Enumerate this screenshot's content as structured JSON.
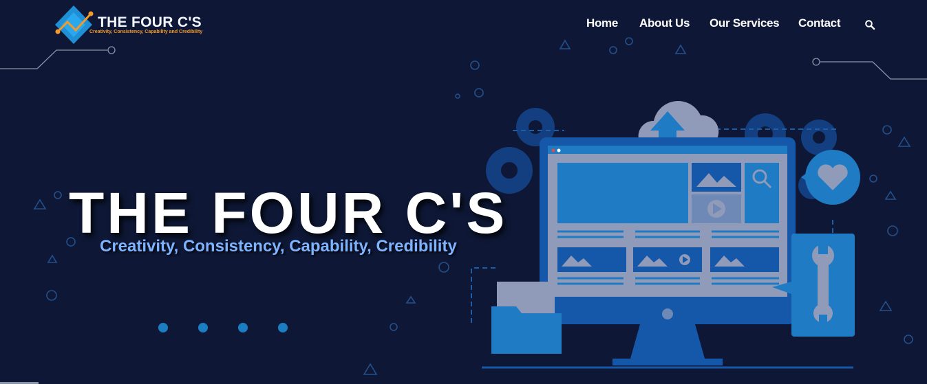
{
  "brand": {
    "name": "THE FOUR C'S",
    "tagline": "Creativity, Consistency, Capability and Credibility"
  },
  "nav": {
    "items": [
      {
        "label": "Home"
      },
      {
        "label": "About Us"
      },
      {
        "label": "Our Services"
      },
      {
        "label": "Contact"
      }
    ],
    "search_icon": "search-icon"
  },
  "hero": {
    "title": "THE FOUR C'S",
    "subtitle": "Creativity, Consistency, Capability, Credibility"
  },
  "slider": {
    "slide_count": 4
  },
  "colors": {
    "background": "#0e1836",
    "accent_blue": "#1b7ec2",
    "subtitle_blue": "#7eb3ff",
    "logo_orange": "#f39a2a"
  }
}
